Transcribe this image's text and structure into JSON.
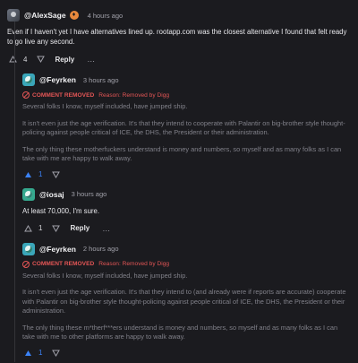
{
  "comments": [
    {
      "user": "@AlexSage",
      "badge": "♦",
      "time": "4 hours ago",
      "text": "Even if I haven't yet I have alternatives lined up. rootapp.com was the closest alternative I found that felt ready to go live any second.",
      "votes": "4",
      "reply_label": "Reply",
      "more": "…"
    },
    {
      "user": "@Feyrken",
      "time": "3 hours ago",
      "removed_label": "COMMENT REMOVED",
      "removed_reason": "Reason: Removed by Digg",
      "paragraphs": [
        "Several folks I know, myself included, have jumped ship.",
        "It isn't even just the age verification. It's that they intend to cooperate with Palantir on big-brother style thought-policing against people critical of ICE, the DHS, the President or their administration.",
        "The only thing these motherfuckers understand is money and numbers, so myself and as many folks as I can take with me are happy to walk away."
      ],
      "votes": "1"
    },
    {
      "user": "@iosaj",
      "time": "3 hours ago",
      "text": "At least 70,000, I'm sure.",
      "votes": "1",
      "reply_label": "Reply",
      "more": "…"
    },
    {
      "user": "@Feyrken",
      "time": "2 hours ago",
      "removed_label": "COMMENT REMOVED",
      "removed_reason": "Reason: Removed by Digg",
      "paragraphs": [
        "Several folks I know, myself included, have jumped ship.",
        "It isn't even just the age verification. It's that they intend to (and already were if reports are accurate) cooperate with Palantir on big-brother style thought-policing against people critical of ICE, the DHS, the President or their administration.",
        "The only thing these m*therf***ers understand is money and numbers, so myself and as many folks as I can take with me to other platforms are happy to walk away."
      ],
      "votes": "1"
    }
  ],
  "colors": {
    "accent": "#3b82f6",
    "removed": "#e25555",
    "badge": "#e8893c"
  }
}
